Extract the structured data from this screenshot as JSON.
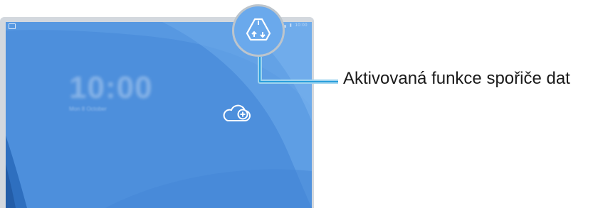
{
  "callout": {
    "label": "Aktivovaná funkce spořiče dat"
  },
  "lock_screen": {
    "clock": "10:00",
    "date": "Mon 8 October"
  },
  "status_bar": {
    "icons": [
      "image-icon",
      "signal-icon",
      "battery-icon"
    ],
    "time": "10:00"
  },
  "icons": {
    "data_saver": "data-saver-icon",
    "cloud_add": "cloud-add-icon"
  },
  "colors": {
    "wallpaper": "#4d8fdc",
    "callout_line": "#2aa0dc",
    "lens_border": "#bdc5cc"
  }
}
